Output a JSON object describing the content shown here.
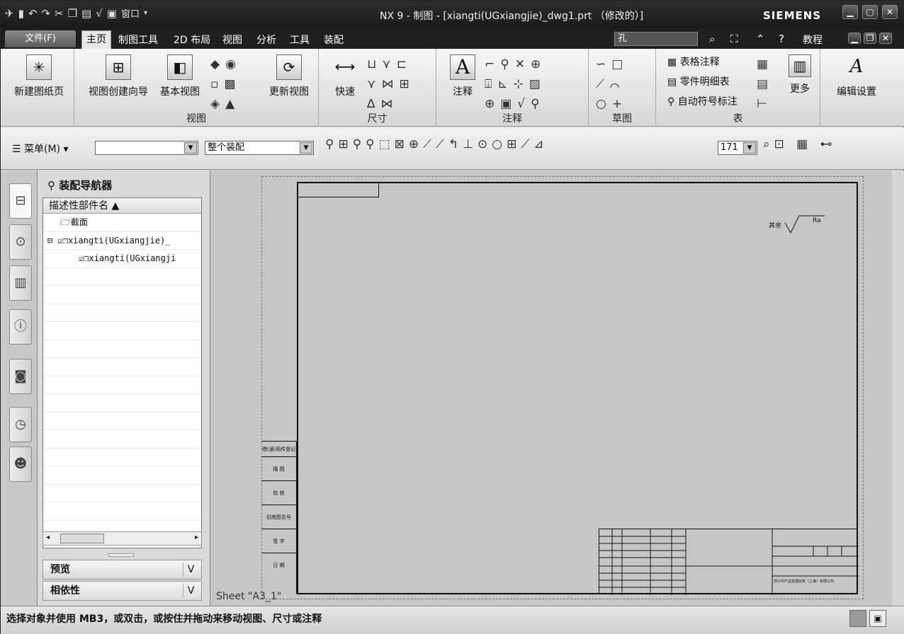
{
  "window": {
    "title": "NX 9 - 制图 - [xiangti(UGxiangjie)_dwg1.prt （修改的）]",
    "brand": "SIEMENS",
    "quick_access": {
      "window_menu": "窗口"
    }
  },
  "menubar": {
    "file": "文件(F)",
    "tabs": [
      "主页",
      "制图工具",
      "2D 布局",
      "视图",
      "分析",
      "工具",
      "装配"
    ],
    "search_value": "孔",
    "tutorial": "教程"
  },
  "ribbon": {
    "new_sheet": "新建图纸页",
    "view_group": {
      "label": "视图",
      "wizard": "视图创建向导",
      "base_view": "基本视图",
      "update_view": "更新视图"
    },
    "dimension_group": {
      "label": "尺寸",
      "rapid": "快速"
    },
    "annotation_group": {
      "label": "注释",
      "note": "注释"
    },
    "sketch_group": {
      "label": "草图"
    },
    "table_group": {
      "label": "表",
      "tabular_note": "表格注释",
      "parts_list": "零件明细表",
      "auto_balloon": "自动符号标注",
      "more": "更多"
    },
    "edit_settings": "编辑设置"
  },
  "toolbar2": {
    "menu": "菜单(M)",
    "filter_value": "",
    "scope_value": "整个装配",
    "scale_value": "171"
  },
  "navigator": {
    "title": "装配导航器",
    "column_header": "描述性部件名",
    "rows": [
      {
        "label": "截面"
      },
      {
        "label": "xiangti(UGxiangjie)_"
      },
      {
        "label": "xiangti(UGxiangji"
      }
    ],
    "panels": [
      "预览",
      "相依性"
    ]
  },
  "drawing": {
    "sheet_label": "Sheet \"A3_1\"",
    "roughness_prefix": "其余",
    "roughness_value": "Ra",
    "side_table_labels": [
      "借(通)用件登记",
      "旧底图总号",
      "签 字",
      "日 期",
      "描 图",
      "校 核"
    ],
    "title_block_company": "浙江中产品管理处有（上海）有限公司"
  },
  "status": {
    "message": "选择对象并使用 MB3，或双击，或按住并拖动来移动视图、尺寸或注释"
  },
  "colors": {
    "titlebar": "#1f1f1f",
    "ribbon": "#e8e8e8",
    "canvas": "#c6c6c6"
  }
}
